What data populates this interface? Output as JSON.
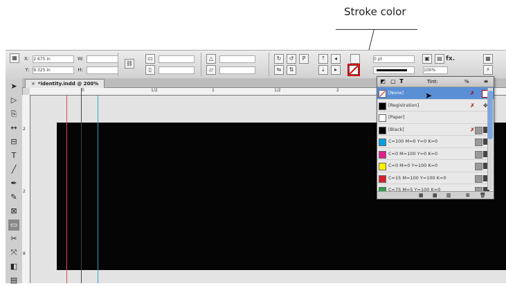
{
  "callout": {
    "label": "Stroke color"
  },
  "control_panel": {
    "x_label": "X:",
    "x_value": "2.675 in",
    "y_label": "Y:",
    "y_value": "9.325 in",
    "w_label": "W:",
    "h_label": "H:",
    "stroke_weight": "0 pt",
    "opacity": "100%",
    "fx_label": "fx."
  },
  "document": {
    "tab_title": "*identity.indd @ 200%",
    "close_glyph": "×"
  },
  "ruler": {
    "labels": [
      "0",
      "1/2",
      "1",
      "1/2",
      "2"
    ],
    "v_labels": [
      "2",
      "2",
      "8"
    ]
  },
  "swatches_panel": {
    "tint_label": "Tint:",
    "tint_value": "%",
    "items": [
      {
        "name": "[None]",
        "color": "#ffffff",
        "selected": true
      },
      {
        "name": "[Registration]",
        "color": "#000000"
      },
      {
        "name": "[Paper]",
        "color": "#ffffff"
      },
      {
        "name": "[Black]",
        "color": "#000000"
      },
      {
        "name": "C=100 M=0 Y=0 K=0",
        "color": "#00a0e0"
      },
      {
        "name": "C=0 M=100 Y=0 K=0",
        "color": "#e0208a"
      },
      {
        "name": "C=0 M=0 Y=100 K=0",
        "color": "#fff000"
      },
      {
        "name": "C=15 M=100 Y=100 K=0",
        "color": "#d42028"
      },
      {
        "name": "C=75 M=5 Y=100 K=0",
        "color": "#2aa24a"
      }
    ]
  },
  "colors": {
    "guide_red": "#e04848",
    "guide_cyan": "#2aa6d6",
    "page_fill": "#050505",
    "selection": "#5a8fd6"
  }
}
